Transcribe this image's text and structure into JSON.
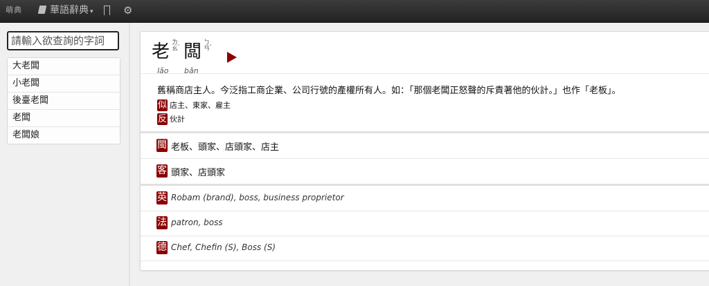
{
  "nav": {
    "logo": "萌典",
    "dict_label": "華語辭典",
    "icons": [
      "book-icon",
      "bookmark-icon",
      "gear-icon"
    ]
  },
  "search": {
    "placeholder": "請輸入欲查詢的字詞"
  },
  "results": [
    "大老闆",
    "小老闆",
    "後臺老闆",
    "老闆",
    "老闆娘"
  ],
  "entry": {
    "chars": [
      {
        "char": "老",
        "bopomofo": [
          "ㄌ",
          "ㄠ"
        ],
        "tone": "ˇ",
        "pinyin": "lǎo"
      },
      {
        "char": "闆",
        "bopomofo": [
          "ㄅ",
          "ㄢ"
        ],
        "tone": "ˇ",
        "pinyin": "bǎn"
      }
    ],
    "definition": "舊稱商店主人。今泛指工商企業、公司行號的產權所有人。如：「那個老闆正怒聲的斥責著他的伙計。」也作「老板」。",
    "synonyms": {
      "badge": "似",
      "text": "店主、東家、雇主"
    },
    "antonyms": {
      "badge": "反",
      "text": "伙計"
    }
  },
  "dialects": [
    {
      "badge": "閩",
      "text": "老板、頭家、店頭家、店主"
    },
    {
      "badge": "客",
      "text": "頭家、店頭家"
    }
  ],
  "translations": [
    {
      "badge": "英",
      "text": "Robam (brand), boss, business proprietor"
    },
    {
      "badge": "法",
      "text": "patron, boss"
    },
    {
      "badge": "德",
      "text": "Chef, Chefin (S), Boss (S)"
    }
  ],
  "colors": {
    "accent": "#8b0000",
    "navbar": "#2a2a2a"
  }
}
